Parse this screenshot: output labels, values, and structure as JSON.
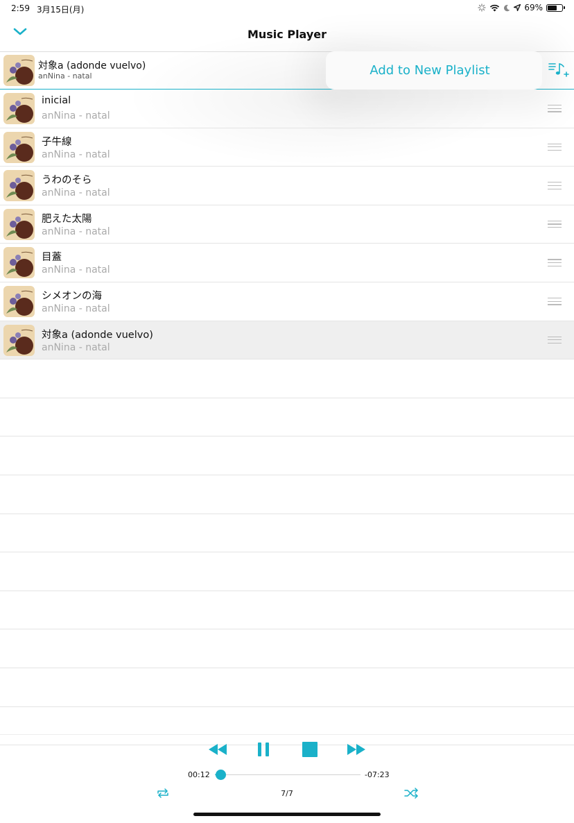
{
  "status": {
    "time": "2:59",
    "date": "3月15日(月)",
    "battery": "69%",
    "battery_level": 0.69
  },
  "nav": {
    "title": "Music Player"
  },
  "now_playing": {
    "title": "対象a (adonde vuelvo)",
    "subtitle": "anNina - natal"
  },
  "popover": {
    "label": "Add to New Playlist"
  },
  "tracks": [
    {
      "title": "inicial",
      "subtitle": "anNina - natal"
    },
    {
      "title": "子牛線",
      "subtitle": "anNina - natal"
    },
    {
      "title": "うわのそら",
      "subtitle": "anNina - natal"
    },
    {
      "title": "肥えた太陽",
      "subtitle": "anNina - natal"
    },
    {
      "title": "目蓋",
      "subtitle": "anNina - natal"
    },
    {
      "title": "シメオンの海",
      "subtitle": "anNina - natal"
    },
    {
      "title": "対象a (adonde vuelvo)",
      "subtitle": "anNina - natal"
    }
  ],
  "player": {
    "elapsed": "00:12",
    "remaining": "-07:23",
    "counter": "7/7",
    "progress_fraction": 0.04
  },
  "colors": {
    "accent": "#1ab1c9"
  },
  "icons": [
    "chevron-down-icon",
    "add-to-playlist-icon",
    "rewind-icon",
    "pause-icon",
    "stop-icon",
    "fast-forward-icon",
    "repeat-icon",
    "shuffle-icon",
    "wifi-icon",
    "location-icon",
    "moon-icon",
    "drag-handle-icon"
  ]
}
